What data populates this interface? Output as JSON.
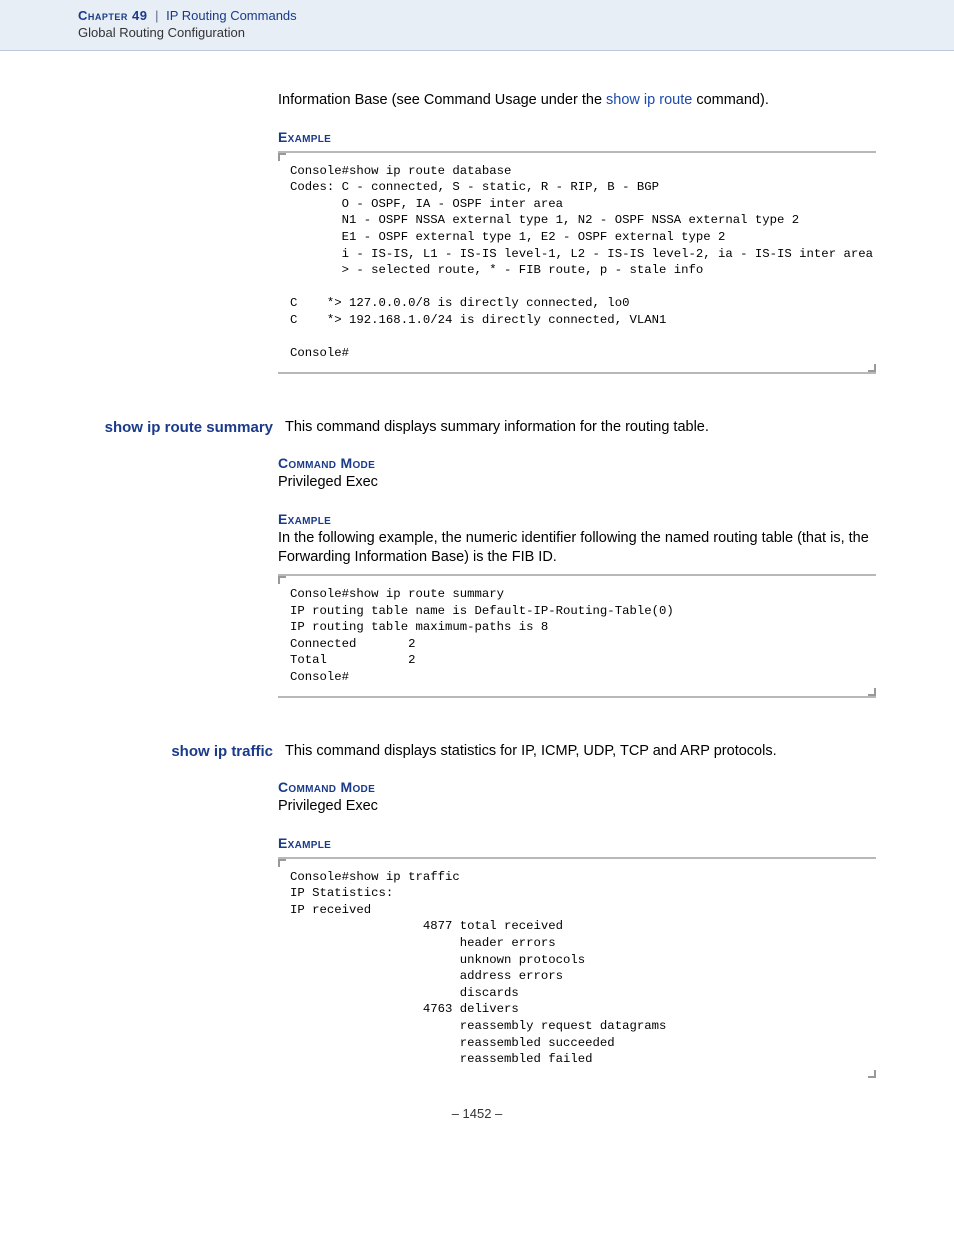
{
  "header": {
    "chapter_label": "Chapter 49",
    "separator": "|",
    "chapter_title": "IP Routing Commands",
    "sub": "Global Routing Configuration"
  },
  "intro": {
    "pre": "Information Base (see Command Usage under the ",
    "link": "show ip route",
    "post": " command)."
  },
  "example_label": "Example",
  "code1": "Console#show ip route database\nCodes: C - connected, S - static, R - RIP, B - BGP\n       O - OSPF, IA - OSPF inter area\n       N1 - OSPF NSSA external type 1, N2 - OSPF NSSA external type 2\n       E1 - OSPF external type 1, E2 - OSPF external type 2\n       i - IS-IS, L1 - IS-IS level-1, L2 - IS-IS level-2, ia - IS-IS inter area\n       > - selected route, * - FIB route, p - stale info\n\nC    *> 127.0.0.0/8 is directly connected, lo0\nC    *> 192.168.1.0/24 is directly connected, VLAN1\n\nConsole#",
  "cmd1": {
    "name": "show ip route summary",
    "desc": "This command displays summary information for the routing table.",
    "mode_label": "Command Mode",
    "mode": "Privileged Exec",
    "example_text": "In the following example, the numeric identifier following the named routing table (that is, the Forwarding Information Base) is the FIB ID."
  },
  "code2": "Console#show ip route summary\nIP routing table name is Default-IP-Routing-Table(0)\nIP routing table maximum-paths is 8\nConnected       2\nTotal           2\nConsole#",
  "cmd2": {
    "name": "show ip traffic",
    "desc": "This command displays statistics for IP, ICMP, UDP, TCP and ARP protocols.",
    "mode_label": "Command Mode",
    "mode": "Privileged Exec"
  },
  "code3": "Console#show ip traffic\nIP Statistics:\nIP received\n                  4877 total received\n                       header errors\n                       unknown protocols\n                       address errors\n                       discards\n                  4763 delivers\n                       reassembly request datagrams\n                       reassembled succeeded\n                       reassembled failed",
  "pagenum": "–  1452  –"
}
